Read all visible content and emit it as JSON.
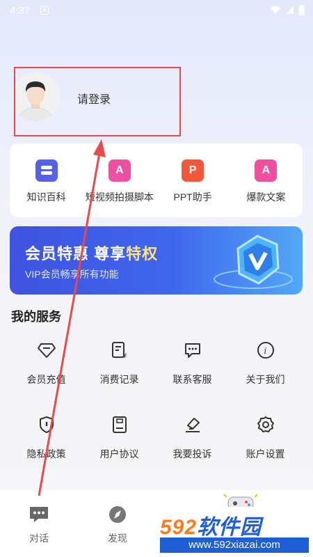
{
  "status_bar": {
    "time": "4:37",
    "a_badge": "A"
  },
  "profile": {
    "login_text": "请登录"
  },
  "tools": [
    {
      "label": "知识百科",
      "icon": "book-icon",
      "glyph": "",
      "color": "#5561e8"
    },
    {
      "label": "短视频拍摄脚本",
      "icon": "a-doc-icon",
      "glyph": "A",
      "color": "#ee4fa0"
    },
    {
      "label": "PPT助手",
      "icon": "p-doc-icon",
      "glyph": "P",
      "color": "#f2573a"
    },
    {
      "label": "爆款文案",
      "icon": "a-doc-icon",
      "glyph": "A",
      "color": "#ee4fa0"
    }
  ],
  "vip": {
    "title_part1": "会员特惠 尊享",
    "title_part2": "特权",
    "subtitle": "VIP会员畅享所有功能"
  },
  "services_title": "我的服务",
  "services": [
    {
      "label": "会员充值",
      "icon": "diamond-icon"
    },
    {
      "label": "消费记录",
      "icon": "receipt-icon"
    },
    {
      "label": "联系客服",
      "icon": "chat-icon"
    },
    {
      "label": "关于我们",
      "icon": "info-icon"
    },
    {
      "label": "隐私政策",
      "icon": "shield-icon"
    },
    {
      "label": "用户协议",
      "icon": "document-icon"
    },
    {
      "label": "我要投诉",
      "icon": "complaint-icon"
    },
    {
      "label": "账户设置",
      "icon": "gear-icon"
    }
  ],
  "nav": [
    {
      "label": "对话",
      "icon": "chat-bubble-icon"
    },
    {
      "label": "发现",
      "icon": "compass-icon"
    }
  ],
  "watermark": {
    "brand_num": "592",
    "brand_text": "软件园",
    "url": "www.592xiazai.com"
  },
  "colors": {
    "accent": "#3f5be6",
    "highlight": "#e64a4a",
    "gold": "#ffe27a"
  }
}
